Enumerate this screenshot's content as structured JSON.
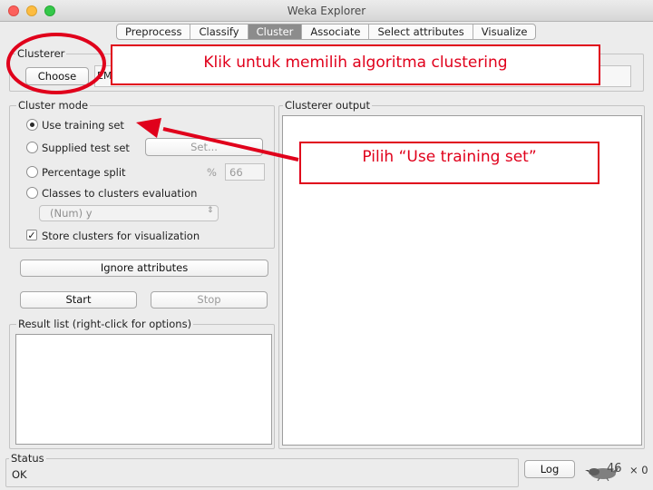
{
  "window": {
    "title": "Weka Explorer"
  },
  "tabs": [
    {
      "label": "Preprocess",
      "active": false
    },
    {
      "label": "Classify",
      "active": false
    },
    {
      "label": "Cluster",
      "active": true
    },
    {
      "label": "Associate",
      "active": false
    },
    {
      "label": "Select attributes",
      "active": false
    },
    {
      "label": "Visualize",
      "active": false
    }
  ],
  "clusterer": {
    "group_label": "Clusterer",
    "choose_label": "Choose",
    "value_fragment": "EM"
  },
  "cluster_mode": {
    "group_label": "Cluster mode",
    "options": [
      {
        "label": "Use training set",
        "selected": true
      },
      {
        "label": "Supplied test set",
        "selected": false
      },
      {
        "label": "Percentage split",
        "selected": false
      },
      {
        "label": "Classes to clusters evaluation",
        "selected": false
      }
    ],
    "set_button": "Set...",
    "percent_symbol": "%",
    "percent_value": "66",
    "class_select": "(Num) y",
    "store_clusters": {
      "label": "Store clusters for visualization",
      "checked": true
    }
  },
  "actions": {
    "ignore_attributes": "Ignore attributes",
    "start": "Start",
    "stop": "Stop"
  },
  "result_list": {
    "label": "Result list (right-click for options)"
  },
  "output": {
    "label": "Clusterer output"
  },
  "status": {
    "label": "Status",
    "text": "OK",
    "log_button": "Log",
    "count": "× 0"
  },
  "annotations": {
    "top": "Klik untuk  memilih algoritma clustering",
    "right": "Pilih “Use training set”",
    "color": "#e0001b"
  },
  "slide_number": "46"
}
